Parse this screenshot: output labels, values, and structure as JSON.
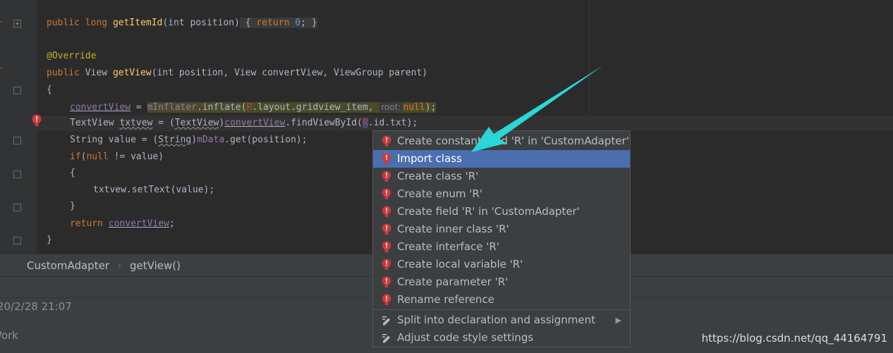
{
  "code": {
    "line1": {
      "kw1": "public",
      "kw2": "long",
      "fn": "getItemId",
      "params": "(int position)",
      "body_open": " { ",
      "kw3": "return",
      "num": "0",
      "body_close": "; }"
    },
    "line2": {
      "ann": "@Override"
    },
    "line3": {
      "kw": "public",
      "type": " View ",
      "fn": "getView",
      "params": "(int position, View convertView, ViewGroup parent)"
    },
    "line4": {
      "brace": "{"
    },
    "line5": {
      "a": "convertView",
      "b": " = ",
      "c": "mInflater",
      "d": ".inflate(",
      "e": "R",
      "f": ".layout.gridview_item, ",
      "hint": "root:",
      "g": "null",
      "h": ");"
    },
    "line6": {
      "a": "TextView ",
      "b": "txtvew",
      "c": " = (",
      "d": "TextView",
      "e": ")",
      "f": "convertView",
      "g": ".findViewById(",
      "h": "R",
      "i": ".id.txt);"
    },
    "line7": {
      "a": "String value = (",
      "b": "String",
      "c": ")",
      "d": "mData",
      "e": ".get(position);"
    },
    "line8": {
      "kw": "if",
      "a": "(",
      "kw2": "null",
      "b": " != value)"
    },
    "line9": {
      "brace": "{"
    },
    "line10": {
      "a": "txtvew.setText(value);"
    },
    "line11": {
      "brace": "}"
    },
    "line12": {
      "kw": "return",
      "b": " ",
      "c": "convertView",
      "d": ";"
    },
    "line13": {
      "brace": "}"
    }
  },
  "breadcrumb": {
    "class_name": "CustomAdapter",
    "separator": "›",
    "method": "getView()"
  },
  "bottom_panel": {
    "timestamp": "20/2/28 21:07",
    "work_label": "Work"
  },
  "watermark": "https://blog.csdn.net/qq_44164791",
  "intention_menu": {
    "items": [
      {
        "label": "Create constant field 'R' in 'CustomAdapter'",
        "icon": "error-bulb-icon"
      },
      {
        "label": "Import class",
        "icon": "error-bulb-icon"
      },
      {
        "label": "Create class 'R'",
        "icon": "error-bulb-icon"
      },
      {
        "label": "Create enum 'R'",
        "icon": "error-bulb-icon"
      },
      {
        "label": "Create field 'R' in 'CustomAdapter'",
        "icon": "error-bulb-icon"
      },
      {
        "label": "Create inner class 'R'",
        "icon": "error-bulb-icon"
      },
      {
        "label": "Create interface 'R'",
        "icon": "error-bulb-icon"
      },
      {
        "label": "Create local variable 'R'",
        "icon": "error-bulb-icon"
      },
      {
        "label": "Create parameter 'R'",
        "icon": "error-bulb-icon"
      },
      {
        "label": "Rename reference",
        "icon": "error-bulb-icon"
      }
    ],
    "extra_items": [
      {
        "label": "Split into declaration and assignment",
        "icon": "pencil-icon",
        "submenu": "▶"
      },
      {
        "label": "Adjust code style settings",
        "icon": "pencil-icon"
      }
    ],
    "selected": "Import class"
  },
  "colors": {
    "selection": "#4b6eaf",
    "error": "#d03838",
    "arrow": "#2ad6d6",
    "keyword": "#cc7832",
    "function": "#ffc66d"
  }
}
